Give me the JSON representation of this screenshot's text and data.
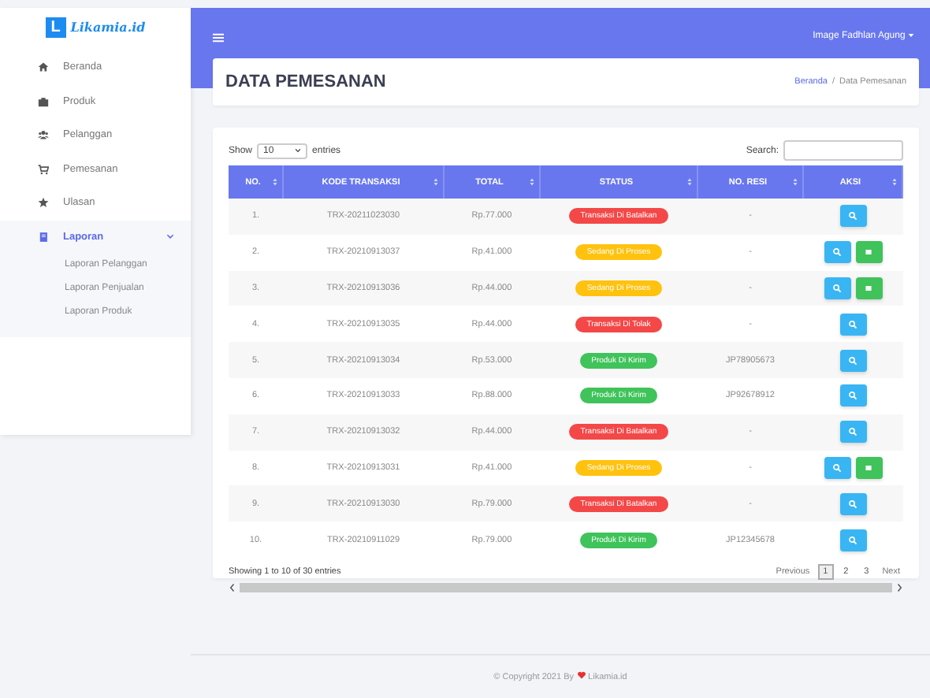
{
  "brand": {
    "letter": "L",
    "name": "Likamia.id"
  },
  "sidebar": {
    "items": [
      {
        "label": "Beranda",
        "selected": false
      },
      {
        "label": "Produk",
        "selected": false
      },
      {
        "label": "Pelanggan",
        "selected": false
      },
      {
        "label": "Pemesanan",
        "selected": false
      },
      {
        "label": "Ulasan",
        "selected": false
      },
      {
        "label": "Laporan",
        "selected": true,
        "expanded": true,
        "children": [
          {
            "label": "Laporan Pelanggan"
          },
          {
            "label": "Laporan Penjualan"
          },
          {
            "label": "Laporan Produk"
          }
        ]
      }
    ]
  },
  "topbar": {
    "user": "Image Fadhlan Agung"
  },
  "page": {
    "title": "DATA PEMESANAN",
    "breadcrumb": [
      {
        "label": "Beranda",
        "kind": "link"
      },
      {
        "label": "/",
        "kind": "separator"
      },
      {
        "label": "Data Pemesanan",
        "kind": "current"
      }
    ]
  },
  "table": {
    "show_label": "Show",
    "entries_value": "10",
    "entries_label": "entries",
    "search_label": "Search:",
    "columns": [
      "NO.",
      "KODE TRANSAKSI",
      "TOTAL",
      "STATUS",
      "NO. RESI",
      "AKSI"
    ],
    "rows": [
      {
        "no": "1.",
        "code": "TRX-20211023030",
        "total": "Rp.77.000",
        "status": {
          "label": "Transaksi Di Batalkan",
          "kind": "cancelled"
        },
        "resi": "-",
        "actions": [
          {
            "kind": "view"
          }
        ]
      },
      {
        "no": "2.",
        "code": "TRX-20210913037",
        "total": "Rp.41.000",
        "status": {
          "label": "Sedang Di Proses",
          "kind": "processing"
        },
        "resi": "-",
        "actions": [
          {
            "kind": "view"
          },
          {
            "kind": "confirm"
          }
        ]
      },
      {
        "no": "3.",
        "code": "TRX-20210913036",
        "total": "Rp.44.000",
        "status": {
          "label": "Sedang Di Proses",
          "kind": "processing"
        },
        "resi": "-",
        "actions": [
          {
            "kind": "view"
          },
          {
            "kind": "confirm"
          }
        ]
      },
      {
        "no": "4.",
        "code": "TRX-20210913035",
        "total": "Rp.44.000",
        "status": {
          "label": "Transaksi Di Tolak",
          "kind": "cancelled"
        },
        "resi": "-",
        "actions": [
          {
            "kind": "view"
          }
        ]
      },
      {
        "no": "5.",
        "code": "TRX-20210913034",
        "total": "Rp.53.000",
        "status": {
          "label": "Produk Di Kirim",
          "kind": "shipped"
        },
        "resi": "JP78905673",
        "actions": [
          {
            "kind": "view"
          }
        ]
      },
      {
        "no": "6.",
        "code": "TRX-20210913033",
        "total": "Rp.88.000",
        "status": {
          "label": "Produk Di Kirim",
          "kind": "shipped"
        },
        "resi": "JP92678912",
        "actions": [
          {
            "kind": "view"
          }
        ]
      },
      {
        "no": "7.",
        "code": "TRX-20210913032",
        "total": "Rp.44.000",
        "status": {
          "label": "Transaksi Di Batalkan",
          "kind": "cancelled"
        },
        "resi": "-",
        "actions": [
          {
            "kind": "view"
          }
        ]
      },
      {
        "no": "8.",
        "code": "TRX-20210913031",
        "total": "Rp.41.000",
        "status": {
          "label": "Sedang Di Proses",
          "kind": "processing"
        },
        "resi": "-",
        "actions": [
          {
            "kind": "view"
          },
          {
            "kind": "confirm"
          }
        ]
      },
      {
        "no": "9.",
        "code": "TRX-20210913030",
        "total": "Rp.79.000",
        "status": {
          "label": "Transaksi Di Batalkan",
          "kind": "cancelled"
        },
        "resi": "-",
        "actions": [
          {
            "kind": "view"
          }
        ]
      },
      {
        "no": "10.",
        "code": "TRX-20210911029",
        "total": "Rp.79.000",
        "status": {
          "label": "Produk Di Kirim",
          "kind": "shipped"
        },
        "resi": "JP12345678",
        "actions": [
          {
            "kind": "view"
          }
        ]
      }
    ],
    "info": "Showing 1 to 10 of 30 entries",
    "pagination": [
      {
        "label": "Previous",
        "kind": "nav",
        "selected": false
      },
      {
        "label": "1",
        "kind": "page",
        "selected": true
      },
      {
        "label": "2",
        "kind": "page",
        "selected": false
      },
      {
        "label": "3",
        "kind": "page",
        "selected": false
      },
      {
        "label": "Next",
        "kind": "nav",
        "selected": false
      }
    ]
  },
  "footer": {
    "before": "© Copyright 2021 By",
    "after": "Likamia.id"
  }
}
